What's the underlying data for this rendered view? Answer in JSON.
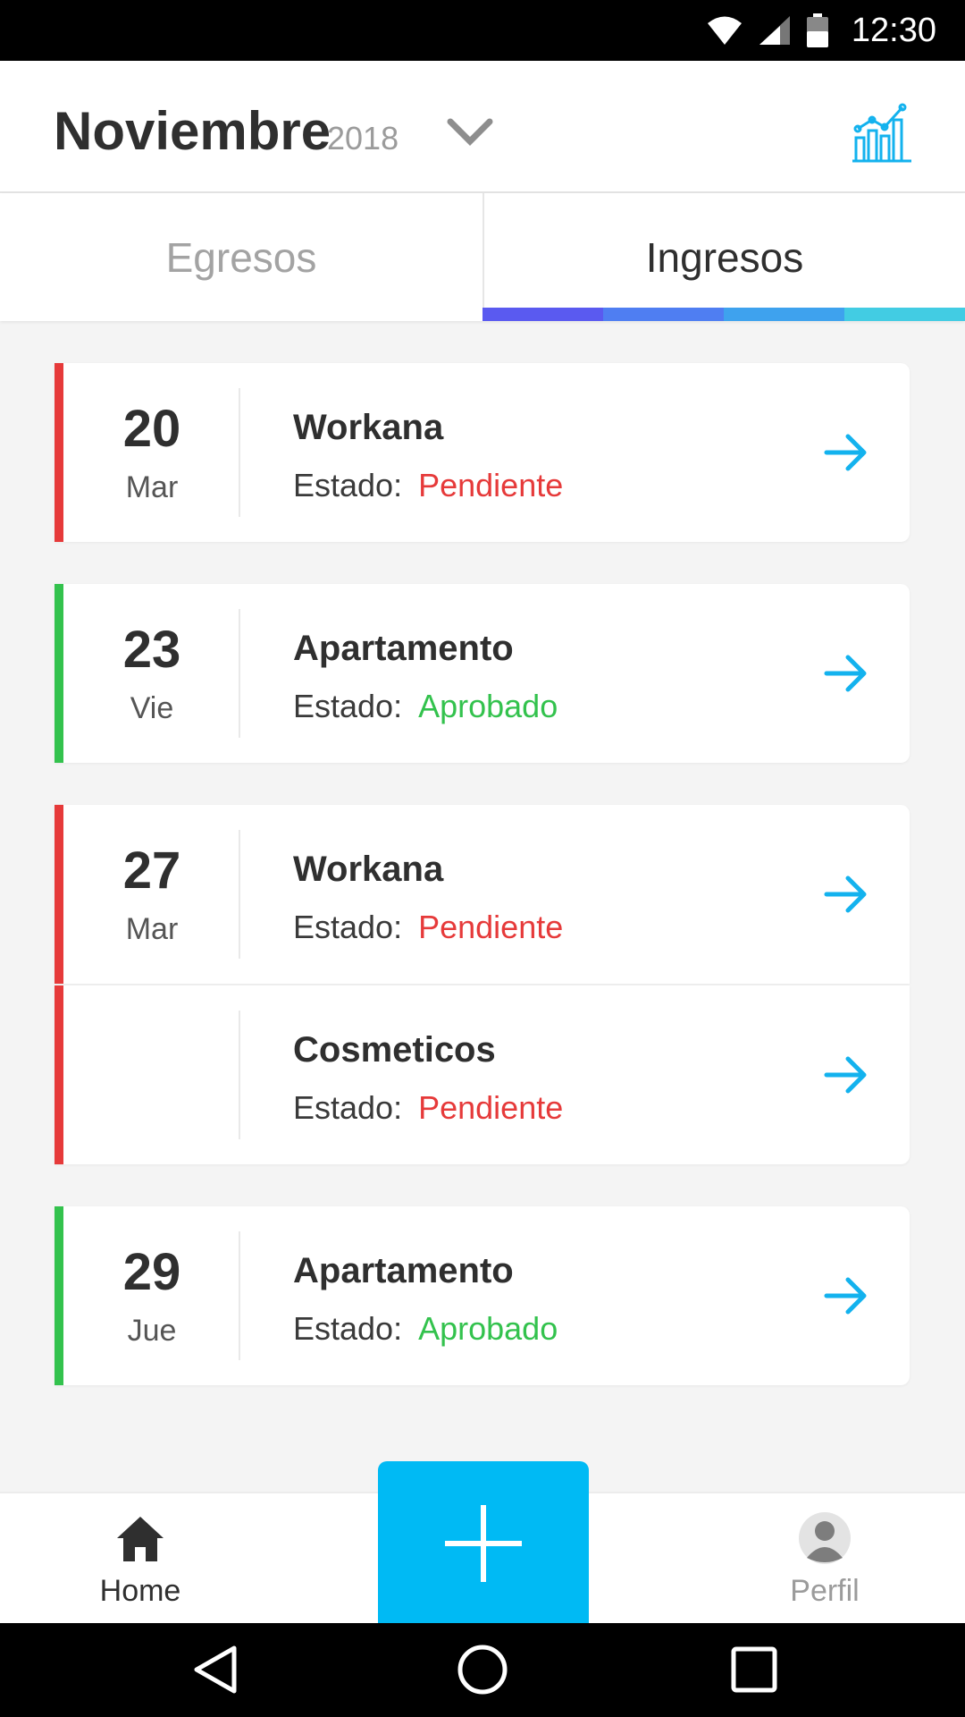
{
  "status_bar": {
    "time": "12:30"
  },
  "header": {
    "month": "Noviembre",
    "year": "2018"
  },
  "tabs": [
    {
      "label": "Egresos",
      "active": false
    },
    {
      "label": "Ingresos",
      "active": true
    }
  ],
  "tab_indicator_colors": [
    "#5a5af0",
    "#4f7ef2",
    "#3ea2ee",
    "#42cce3"
  ],
  "colors": {
    "pending": "#e63a3a",
    "approved": "#33c24d",
    "accent": "#00baf4",
    "arrow": "#13b2ee"
  },
  "estado_label": "Estado:",
  "entries": [
    {
      "day": "20",
      "weekday": "Mar",
      "title": "Workana",
      "status": "Pendiente"
    },
    {
      "day": "23",
      "weekday": "Vie",
      "title": "Apartamento",
      "status": "Aprobado"
    },
    {
      "day": "27",
      "weekday": "Mar",
      "title": "Workana",
      "status": "Pendiente"
    },
    {
      "day": "",
      "weekday": "",
      "title": "Cosmeticos",
      "status": "Pendiente"
    },
    {
      "day": "29",
      "weekday": "Jue",
      "title": "Apartamento",
      "status": "Aprobado"
    }
  ],
  "bottom_nav": {
    "home_label": "Home",
    "profile_label": "Perfil",
    "home_icon": "home-icon",
    "add_icon": "plus-icon",
    "profile_icon": "avatar-icon"
  }
}
